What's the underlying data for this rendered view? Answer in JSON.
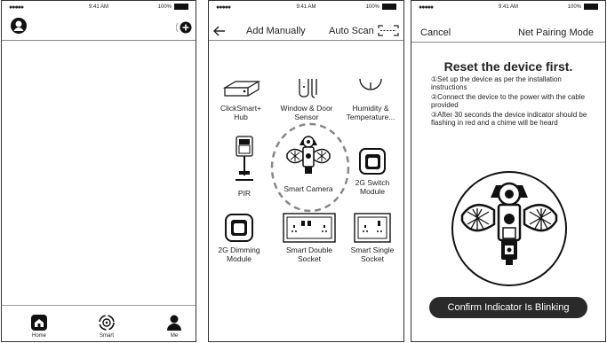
{
  "status": {
    "time": "9:41 AM",
    "battery": "100%"
  },
  "screen1": {
    "tabs": [
      {
        "label": "Home"
      },
      {
        "label": "Smart"
      },
      {
        "label": "Me"
      }
    ]
  },
  "screen2": {
    "back_icon": "arrow-left-icon",
    "title": "Add Manually",
    "auto_scan": "Auto Scan",
    "devices": [
      {
        "label": "ClickSmart+ Hub"
      },
      {
        "label": "Window & Door Sensor"
      },
      {
        "label": "Humidity & Temperature..."
      },
      {
        "label": "PIR"
      },
      {
        "label": "Smart Camera"
      },
      {
        "label": "2G Switch Module"
      },
      {
        "label": "2G Dimming Module"
      },
      {
        "label": "Smart Double Socket"
      },
      {
        "label": "Smart Single Socket"
      }
    ]
  },
  "screen3": {
    "cancel": "Cancel",
    "mode": "Net Pairing Mode",
    "heading": "Reset the device first.",
    "steps": [
      {
        "num": "①",
        "text": "Set up the device as per the installation instructions"
      },
      {
        "num": "②",
        "text": "Connect the device to the power with the cable provided"
      },
      {
        "num": "③",
        "text": "After 30 seconds the device indicator should be flashing in red and a chime will be heard"
      }
    ],
    "confirm": "Confirm Indicator Is Blinking"
  }
}
